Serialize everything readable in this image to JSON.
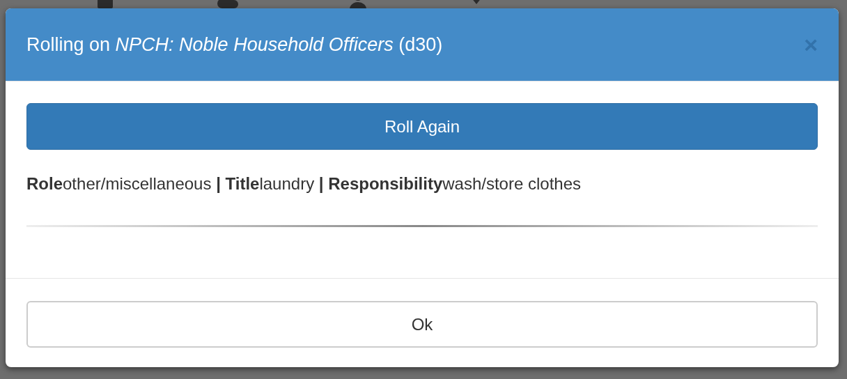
{
  "modal": {
    "title": "Rolling on *NPCH: Noble Household Officers* (d30)",
    "close": "×",
    "roll_button": "Roll Again",
    "result": "**Role**other/miscellaneous **|** **Title**laundry **|** **Responsibility**wash/store clothes",
    "ok_button": "Ok"
  }
}
